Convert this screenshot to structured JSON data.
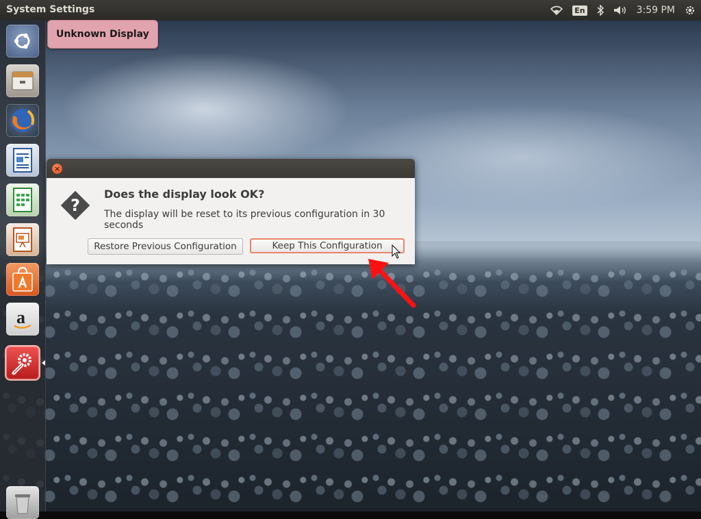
{
  "top_panel": {
    "window_title": "System Settings",
    "language": "En",
    "clock": "3:59 PM"
  },
  "launcher": {
    "items": [
      {
        "name": "dash-home",
        "icon": "ubuntu-logo-icon"
      },
      {
        "name": "files",
        "icon": "file-cabinet-icon"
      },
      {
        "name": "firefox",
        "icon": "firefox-icon"
      },
      {
        "name": "writer",
        "icon": "document-icon"
      },
      {
        "name": "calc",
        "icon": "spreadsheet-icon"
      },
      {
        "name": "impress",
        "icon": "presentation-icon"
      },
      {
        "name": "software-center",
        "icon": "shopping-bag-icon"
      },
      {
        "name": "amazon",
        "icon": "amazon-icon"
      },
      {
        "name": "system-settings",
        "icon": "wrench-gear-icon"
      },
      {
        "name": "trash",
        "icon": "trash-icon"
      }
    ],
    "tooltip": "Unknown Display"
  },
  "dialog": {
    "heading": "Does the display look OK?",
    "message": "The display will be reset to its previous configuration in 30 seconds",
    "restore_label": "Restore Previous Configuration",
    "keep_label": "Keep This Configuration"
  },
  "colors": {
    "accent": "#e9846a",
    "annotation_arrow": "#ff1111",
    "tooltip_bg": "#e1a3ad",
    "panel_bg": "#3c3b37"
  }
}
